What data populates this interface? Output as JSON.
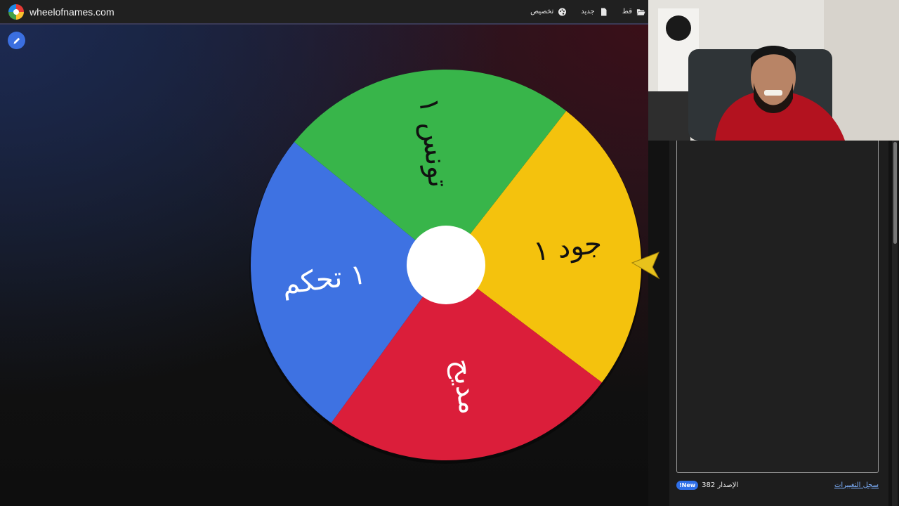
{
  "header": {
    "site_name": "wheelofnames.com",
    "menu": [
      {
        "label": "قط",
        "icon": "folder-open-icon"
      },
      {
        "label": "جديد",
        "icon": "file-icon"
      },
      {
        "label": "تخصيص",
        "icon": "palette-icon"
      }
    ]
  },
  "wheel": {
    "segments": [
      {
        "label": "جود ١",
        "color": "#f4c20d",
        "text_color": "#111111"
      },
      {
        "label": "مديح",
        "color": "#db1e3a",
        "text_color": "#ffffff"
      },
      {
        "label": "١ تحكم",
        "color": "#3e72e2",
        "text_color": "#ffffff"
      },
      {
        "label": "تونس ١",
        "color": "#38b54a",
        "text_color": "#111111"
      }
    ],
    "pointer_color": "#e8c21c",
    "hub_color": "#ffffff"
  },
  "panel": {
    "changelog_link": "سجل التغييرات",
    "version_label": "الإصدار 382",
    "new_badge": "New!"
  },
  "colors": {
    "accent": "#3b6fe0",
    "topbar": "#202020"
  }
}
